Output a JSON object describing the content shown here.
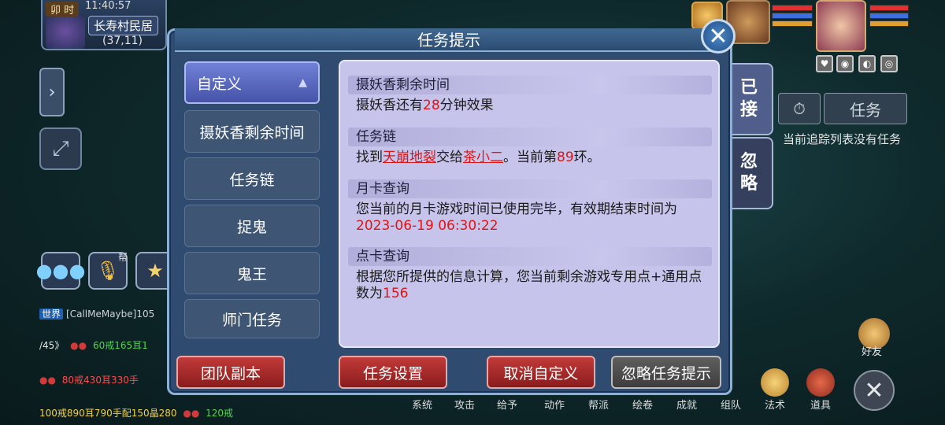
{
  "hud": {
    "time_tag": "卯 时",
    "clock": "11:40:57",
    "location_name": "长寿村民居",
    "coordinates": "(37,11)"
  },
  "dialog": {
    "title": "任务提示",
    "categories": [
      {
        "label": "自定义"
      },
      {
        "label": "摄妖香剩余时间"
      },
      {
        "label": "任务链"
      },
      {
        "label": "捉鬼"
      },
      {
        "label": "鬼王"
      },
      {
        "label": "师门任务"
      }
    ],
    "sections": {
      "incense": {
        "heading": "摄妖香剩余时间",
        "prefix": "摄妖香还有",
        "minutes": "28",
        "suffix": "分钟效果"
      },
      "chain": {
        "heading": "任务链",
        "text1": "找到",
        "place": "天崩地裂",
        "text2": "交给",
        "npc": "茶小二",
        "text3": "。当前第",
        "round": "89",
        "text4": "环。"
      },
      "monthly": {
        "heading": "月卡查询",
        "text": "您当前的月卡游戏时间已使用完毕，有效期结束时间为",
        "expiry": "2023-06-19 06:30:22"
      },
      "points": {
        "heading": "点卡查询",
        "text": "根据您所提供的信息计算，您当前剩余游戏专用点+通用点数为",
        "value": "156"
      }
    },
    "buttons": {
      "team_dungeon": "团队副本",
      "task_settings": "任务设置",
      "cancel_custom": "取消自定义",
      "ignore_hint": "忽略任务提示"
    }
  },
  "right_panel": {
    "tab_accepted": "已\n接",
    "tab_ignored": "忽\n略",
    "task_button": "任务",
    "empty_text": "当前追踪列表没有任务"
  },
  "chat": {
    "world_tag": "世界",
    "line1_text": "[CallMeMaybe]105",
    "line2_text": "/45》",
    "line2_green": "60戒165耳1",
    "line3_red": "80戒430耳330手",
    "line4_yellow": "100戒890耳790手配150晶280",
    "line4_green": "120戒"
  },
  "voice_tag": "帮",
  "bottom_bar": [
    "系统",
    "攻击",
    "给予",
    "动作",
    "帮派",
    "绘卷",
    "成就",
    "组队",
    "法术",
    "道具"
  ],
  "friends_label": "好友",
  "colors": {
    "dialog_bg": "#2f4b70",
    "content_bg": "#c6c4ea",
    "accent_red": "#e01414",
    "active_tab": "#5b69c4"
  }
}
